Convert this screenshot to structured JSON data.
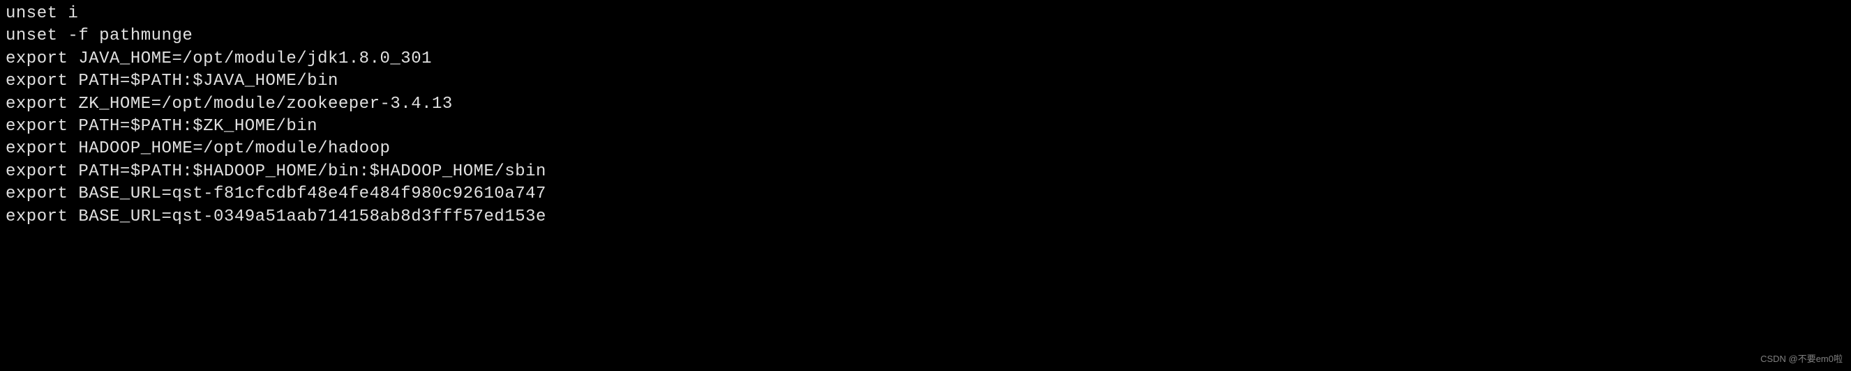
{
  "terminal": {
    "lines": [
      "unset i",
      "unset -f pathmunge",
      "export JAVA_HOME=/opt/module/jdk1.8.0_301",
      "export PATH=$PATH:$JAVA_HOME/bin",
      "export ZK_HOME=/opt/module/zookeeper-3.4.13",
      "export PATH=$PATH:$ZK_HOME/bin",
      "export HADOOP_HOME=/opt/module/hadoop",
      "export PATH=$PATH:$HADOOP_HOME/bin:$HADOOP_HOME/sbin",
      "export BASE_URL=qst-f81cfcdbf48e4fe484f980c92610a747",
      "export BASE_URL=qst-0349a51aab714158ab8d3fff57ed153e"
    ]
  },
  "watermark": {
    "text": "CSDN @不要em0啦"
  }
}
